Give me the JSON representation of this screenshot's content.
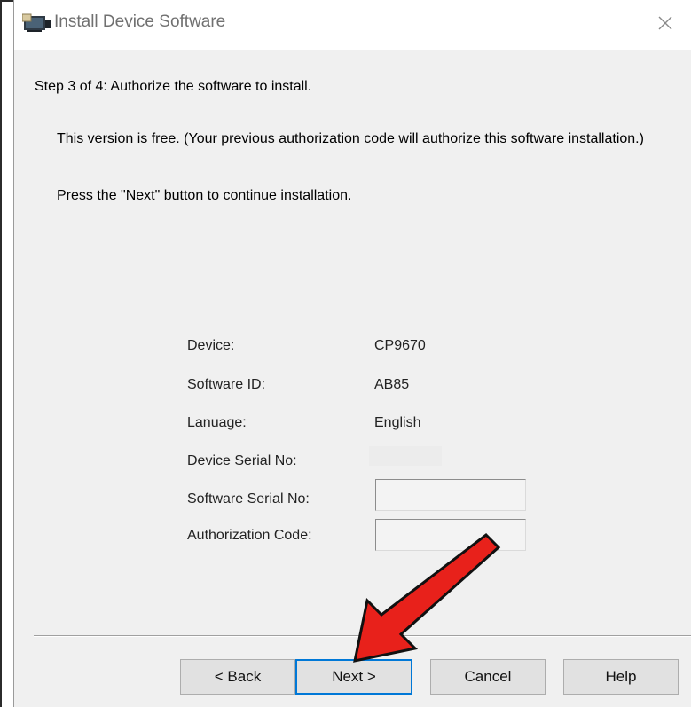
{
  "window": {
    "title": "Install Device Software",
    "close_glyph": "✕"
  },
  "step": {
    "heading": "Step 3 of 4:  Authorize the software to install."
  },
  "messages": {
    "line1": "This version is free. (Your previous authorization code will authorize this software installation.)",
    "line2": "Press the \"Next\" button to continue installation."
  },
  "fields": {
    "device_label": "Device:",
    "device_value": "CP9670",
    "software_id_label": "Software ID:",
    "software_id_value": "AB85",
    "language_label": "Lanuage:",
    "language_value": "English",
    "device_serial_label": "Device Serial No:",
    "device_serial_value": "",
    "software_serial_label": "Software Serial No:",
    "software_serial_value": "",
    "authorization_code_label": "Authorization Code:",
    "authorization_code_value": ""
  },
  "buttons": {
    "back": "< Back",
    "next": "Next >",
    "cancel": "Cancel",
    "help": "Help"
  },
  "annotation": {
    "arrow_color": "#e8211b",
    "arrow_icon": "red-arrow-pointing-to-next"
  },
  "colors": {
    "dialog_background": "#f0f0f0",
    "titlebar_background": "#ffffff",
    "button_face": "#e1e1e1"
  }
}
